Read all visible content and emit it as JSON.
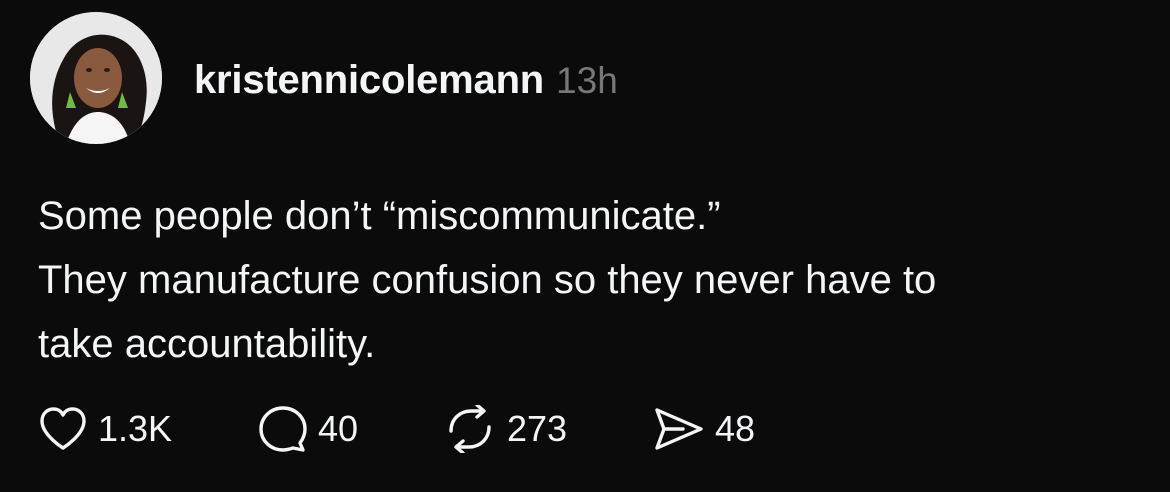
{
  "post": {
    "username": "kristennicolemann",
    "timestamp": "13h",
    "lines": [
      "Some people don’t “miscommunicate.”",
      "They manufacture confusion so they never have to",
      "take accountability."
    ],
    "actions": {
      "likes": "1.3K",
      "replies": "40",
      "reposts": "273",
      "shares": "48"
    }
  },
  "icons": {
    "like": "heart-icon",
    "reply": "speech-bubble-icon",
    "repost": "repost-arrows-icon",
    "share": "paper-plane-icon"
  },
  "colors": {
    "background": "#0b0b0b",
    "text": "#f3f5f7",
    "timestamp": "#777777"
  }
}
